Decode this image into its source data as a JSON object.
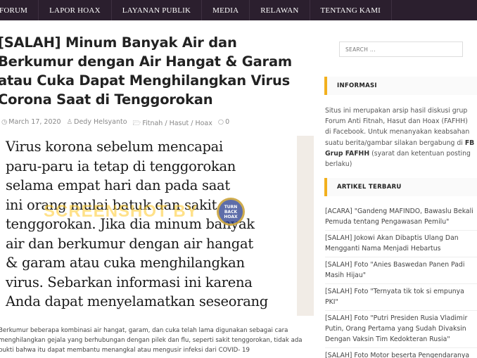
{
  "nav": {
    "items": [
      "FORUM",
      "LAPOR HOAX",
      "LAYANAN PUBLIK",
      "MEDIA",
      "RELAWAN",
      "TENTANG KAMI"
    ]
  },
  "article": {
    "title": "[SALAH] Minum Banyak Air dan Berkumur dengan Air Hangat & Garam atau Cuka Dapat Menghilangkan Virus Corona Saat di Tenggorokan",
    "date": "March 17, 2020",
    "author": "Dedy Helsyanto",
    "category": "Fitnah / Hasut / Hoax",
    "comments": "0",
    "image": {
      "lines": [
        "Virus korona sebelum mencapai",
        "paru-paru ia tetap di tenggorokan",
        "selama empat hari dan pada saat",
        "ini orang mulai batuk dan sakit",
        "tenggorokan. Jika dia minum banyak",
        "air dan berkumur dengan air hangat",
        "& garam atau cuka menghilangkan",
        "virus. Sebarkan informasi ini karena",
        "Anda dapat menyelamatkan seseorang"
      ],
      "watermark": "SCREENSHOT BY",
      "seal": "TURN BACK HOAX"
    },
    "excerpt": "Berkumur beberapa kombinasi air hangat, garam, dan cuka telah lama digunakan sebagai cara menghilangkan gejala yang berhubungan dengan pilek dan flu, seperti sakit tenggorokan, tidak ada bukti bahwa itu dapat membantu menangkal atau mengusir infeksi dari COVID- 19"
  },
  "sidebar": {
    "search_placeholder": "SEARCH ...",
    "info_heading": "INFORMASI",
    "info_text": "Situs ini merupakan arsip hasil diskusi grup Forum Anti Fitnah, Hasut dan Hoax (FAFHH) di Facebook. Untuk menanyakan keabsahan suatu berita/gambar silakan bergabung di",
    "info_link": "FB Grup FAFHH",
    "info_suffix": "(syarat dan ketentuan posting berlaku)",
    "recent_heading": "ARTIKEL TERBARU",
    "recent": [
      "[ACARA] \"Gandeng MAFINDO, Bawaslu Bekali Pemuda tentang Pengawasan Pemilu\"",
      "[SALAH] Jokowi Akan Dibaptis Ulang Dan Mengganti Nama Menjadi Hebartus",
      "[SALAH] Foto \"Anies Baswedan Panen Padi Masih Hijau\"",
      "[SALAH] Foto \"Ternyata tik tok si empunya PKI\"",
      "[SALAH] Foto \"Putri Presiden Rusia Vladimir Putin, Orang Pertama yang Sudah Divaksin Dengan Vaksin Tim Kedokteran Rusia\"",
      "[SALAH] Foto Motor beserta Pengendaranya Terbakar Akibat Ponsel"
    ]
  }
}
